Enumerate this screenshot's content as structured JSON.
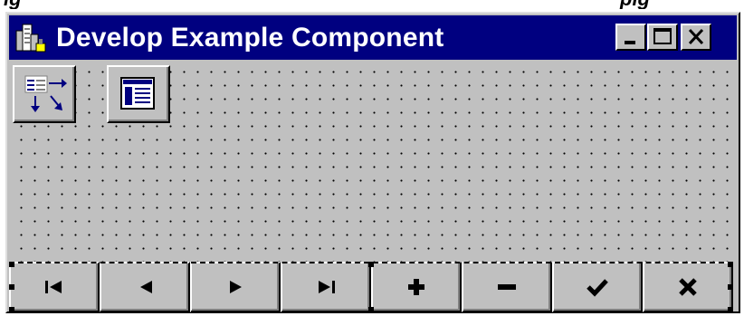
{
  "page_caption": {
    "left_text": "ig",
    "right_text": "pig"
  },
  "window": {
    "title": "Develop Example Component",
    "icon": "component-app-icon",
    "controls": {
      "minimize_icon": "minimize-icon",
      "maximize_icon": "maximize-icon",
      "close_icon": "close-icon"
    }
  },
  "palette": {
    "buttons": [
      {
        "name": "table-to-fields-icon"
      },
      {
        "name": "table-form-icon"
      }
    ]
  },
  "navigator": {
    "buttons": [
      {
        "name": "first-record-icon"
      },
      {
        "name": "prior-record-icon"
      },
      {
        "name": "next-record-icon"
      },
      {
        "name": "last-record-icon"
      },
      {
        "name": "insert-record-icon"
      },
      {
        "name": "delete-record-icon"
      },
      {
        "name": "post-edit-icon"
      },
      {
        "name": "cancel-edit-icon"
      }
    ]
  },
  "colors": {
    "titlebar": "#000080",
    "face": "#c0c0c0",
    "highlight": "#ffffff",
    "shadow": "#808080"
  }
}
